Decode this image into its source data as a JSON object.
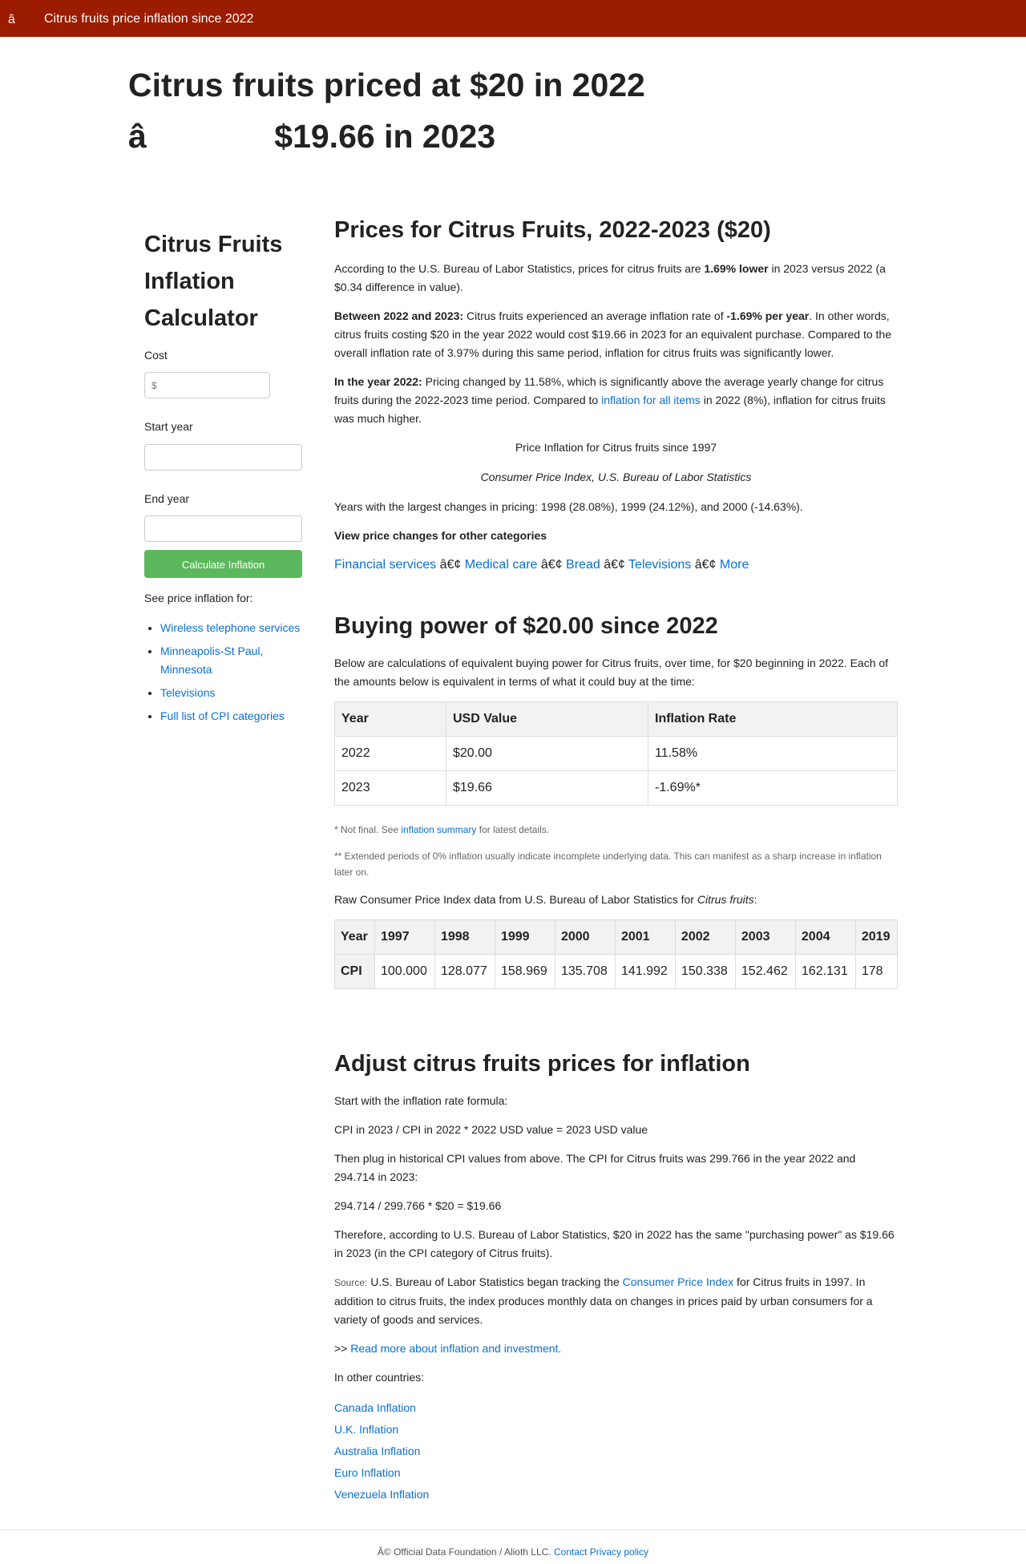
{
  "topbar": {
    "glyph": "â",
    "title": "Citrus fruits price inflation since 2022"
  },
  "hero": {
    "title": "Citrus fruits priced at $20 in 2022 â              $19.66 in 2023"
  },
  "sidebar": {
    "title": "Citrus Fruits Inflation Calculator",
    "cost_label": "Cost",
    "cost_placeholder": "$",
    "start_label": "Start year",
    "end_label": "End year",
    "button": "Calculate Inflation",
    "see_label": "See price inflation for:",
    "links": [
      "Wireless telephone services",
      "Minneapolis-St Paul, Minnesota",
      "Televisions",
      "Full list of CPI categories"
    ]
  },
  "prices": {
    "heading": "Prices for Citrus Fruits, 2022-2023 ($20)",
    "p1_a": "According to the U.S. Bureau of Labor Statistics, prices for citrus fruits are ",
    "p1_b": "1.69% lower",
    "p1_c": " in 2023 versus 2022 (a $0.34 difference in value).",
    "p2_a": "Between 2022 and 2023:",
    "p2_b": " Citrus fruits experienced an average inflation rate of ",
    "p2_c": "-1.69% per year",
    "p2_d": ". In other words, citrus fruits costing $20 in the year 2022 would cost $19.66 in 2023 for an equivalent purchase. Compared to the overall inflation rate of 3.97% during this same period, inflation for citrus fruits was significantly lower.",
    "p3_a": "In the year 2022:",
    "p3_b": " Pricing changed by 11.58%, which is significantly above the average yearly change for citrus fruits during the 2022-2023 time period. Compared to ",
    "p3_link": "inflation for all items",
    "p3_c": " in 2022 (8%), inflation for citrus fruits was much higher.",
    "chart_title": "Price Inflation for Citrus fruits since 1997",
    "chart_source": "Consumer Price Index, U.S. Bureau of Labor Statistics",
    "largest": "Years with the largest changes in pricing: 1998 (28.08%), 1999 (24.12%), and 2000 (-14.63%).",
    "other_heading": "View price changes for other categories",
    "cats": [
      "Financial services",
      "Medical care",
      "Bread",
      "Televisions",
      "More"
    ],
    "sep": " â€¢ "
  },
  "buying": {
    "heading": "Buying power of $20.00 since 2022",
    "intro": "Below are calculations of equivalent buying power for Citrus fruits, over time, for $20 beginning in 2022. Each of the amounts below is equivalent in terms of what it could buy at the time:",
    "headers": [
      "Year",
      "USD Value",
      "Inflation Rate"
    ],
    "rows": [
      [
        "2022",
        "$20.00",
        "11.58%"
      ],
      [
        "2023",
        "$19.66",
        "-1.69%*"
      ]
    ],
    "note1_a": "* Not final. See ",
    "note1_link": "inflation summary",
    "note1_b": " for latest details.",
    "note2": "** Extended periods of 0% inflation usually indicate incomplete underlying data. This can manifest as a sharp increase in inflation later on.",
    "raw_a": "Raw Consumer Price Index data from U.S. Bureau of Labor Statistics for ",
    "raw_b": "Citrus fruits",
    "raw_c": ":",
    "cpi_year_label": "Year",
    "cpi_label": "CPI",
    "cpi_years": [
      "1997",
      "1998",
      "1999",
      "2000",
      "2001",
      "2002",
      "2003",
      "2004",
      "2019"
    ],
    "cpi_values": [
      "100.000",
      "128.077",
      "158.969",
      "135.708",
      "141.992",
      "150.338",
      "152.462",
      "162.131",
      "178"
    ]
  },
  "adjust": {
    "heading": "Adjust citrus fruits prices for inflation",
    "p1": "Start with the inflation rate formula:",
    "formula": "CPI in 2023 / CPI in 2022 * 2022 USD value = 2023 USD value",
    "p2": "Then plug in historical CPI values from above. The CPI for Citrus fruits was 299.766 in the year 2022 and 294.714 in 2023:",
    "calc": "294.714 / 299.766 * $20 = $19.66",
    "p3": "Therefore, according to U.S. Bureau of Labor Statistics, $20 in 2022 has the same \"purchasing power\" as $19.66 in 2023 (in the CPI category of Citrus fruits).",
    "source_label": "Source:",
    "source_a": " U.S. Bureau of Labor Statistics began tracking the ",
    "source_link": "Consumer Price Index",
    "source_b": " for Citrus fruits in 1997. In addition to citrus fruits, the index produces monthly data on changes in prices paid by urban consumers for a variety of goods and services.",
    "readmore_prefix": ">> ",
    "readmore_link": "Read more about inflation and investment.",
    "other_countries": "In other countries:",
    "countries": [
      "Canada Inflation",
      "U.K. Inflation",
      "Australia Inflation",
      "Euro Inflation",
      "Venezuela Inflation"
    ]
  },
  "footer": {
    "text": "Â© Official Data Foundation / Alioth LLC. ",
    "contact": "Contact",
    "privacy": "Privacy policy"
  }
}
